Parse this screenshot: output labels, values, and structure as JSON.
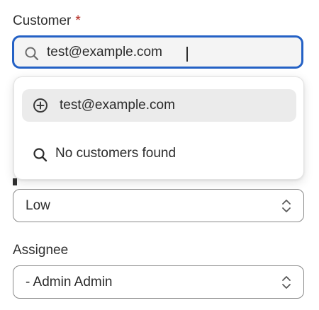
{
  "customer": {
    "label": "Customer",
    "required_mark": "*",
    "search_value": "test@example.com",
    "options": [
      {
        "label": "test@example.com",
        "icon": "plus-circle-icon"
      }
    ],
    "empty_message": "No customers found",
    "empty_icon": "search-icon"
  },
  "priority": {
    "selected": "Low"
  },
  "assignee": {
    "label": "Assignee",
    "selected": "- Admin Admin"
  },
  "colors": {
    "focus_border": "#2461c5",
    "required": "#b3261e"
  }
}
